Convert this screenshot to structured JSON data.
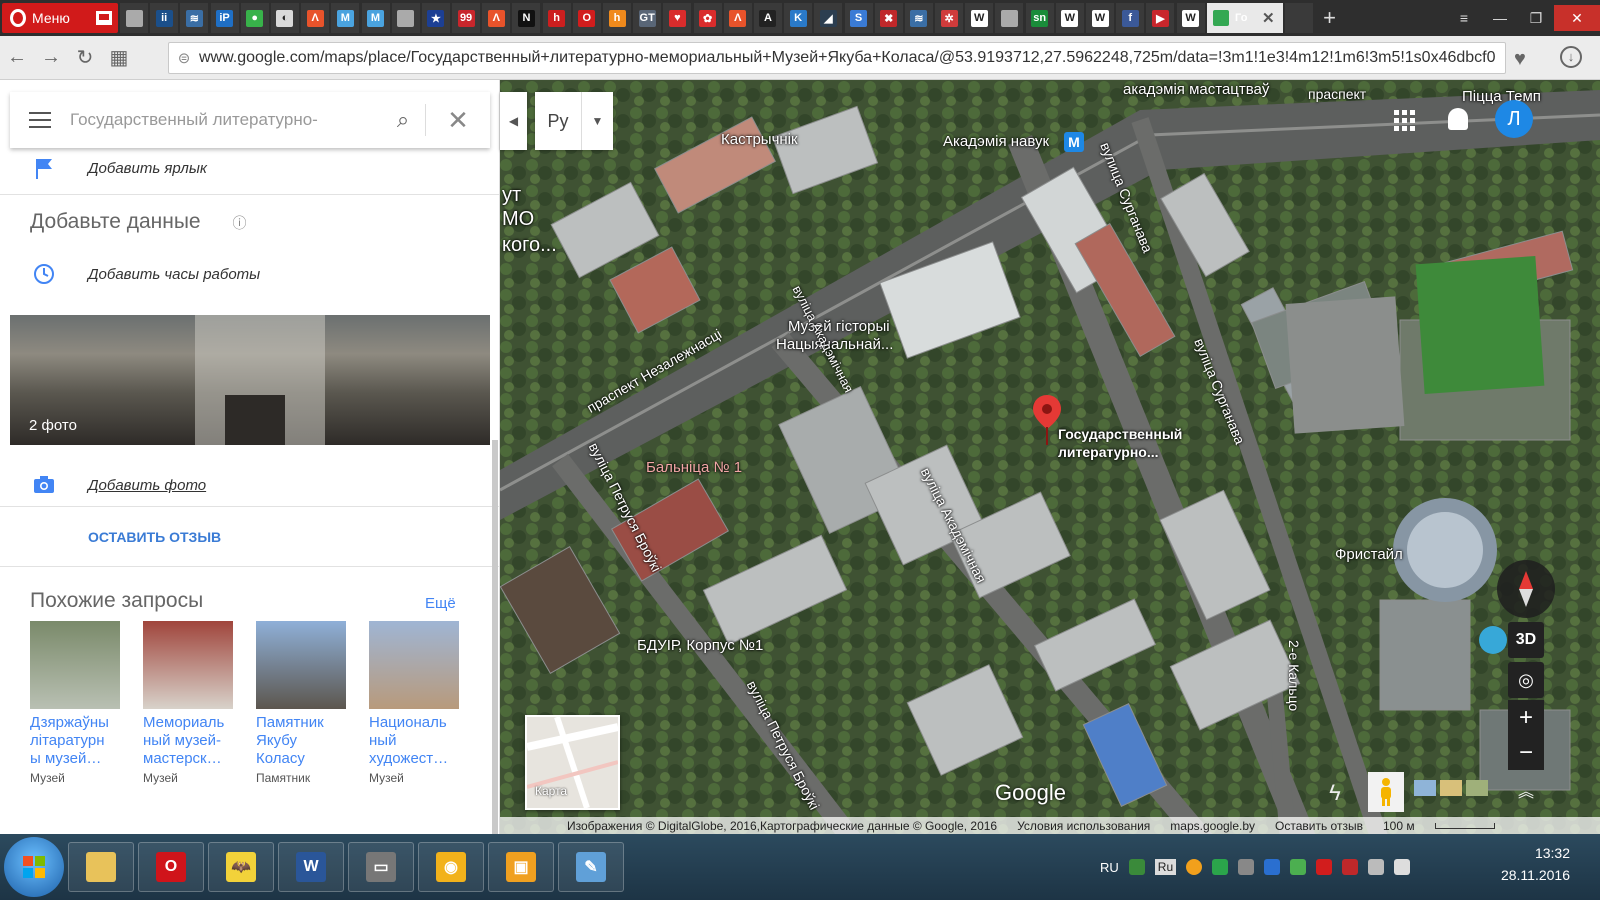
{
  "browser": {
    "menu_label": "Меню",
    "active_tab_label": "Го",
    "url": "www.google.com/maps/place/Государственный+литературно-мемориальный+Музей+Якуба+Коласа/@53.9193712,27.5962248,725m/data=!3m1!1e3!4m12!1m6!3m5!1s0x46dbcf0",
    "tab_icons": [
      {
        "label": "",
        "color": "#aaaaaa"
      },
      {
        "label": "ii",
        "color": "#1b4f8a"
      },
      {
        "label": "≋",
        "color": "#3a6ea5"
      },
      {
        "label": "iP",
        "color": "#1f6fc5"
      },
      {
        "label": "●",
        "color": "#38b24a"
      },
      {
        "label": "◐",
        "color": "#d9d9d9"
      },
      {
        "label": "Λ",
        "color": "#e8532b"
      },
      {
        "label": "M",
        "color": "#4aa3df"
      },
      {
        "label": "M",
        "color": "#4aa3df"
      },
      {
        "label": "",
        "color": "#aaaaaa"
      },
      {
        "label": "★",
        "color": "#1c3f94"
      },
      {
        "label": "99",
        "color": "#c8262c"
      },
      {
        "label": "Λ",
        "color": "#e8532b"
      },
      {
        "label": "N",
        "color": "#111111"
      },
      {
        "label": "h",
        "color": "#cc1f1f"
      },
      {
        "label": "O",
        "color": "#d21d1d"
      },
      {
        "label": "h",
        "color": "#f08a1c"
      },
      {
        "label": "GT",
        "color": "#596677"
      },
      {
        "label": "♥",
        "color": "#d92c2c"
      },
      {
        "label": "✿",
        "color": "#d92c2c"
      },
      {
        "label": "Λ",
        "color": "#e8532b"
      },
      {
        "label": "A",
        "color": "#222222"
      },
      {
        "label": "K",
        "color": "#2a7ac9"
      },
      {
        "label": "◢",
        "color": "#2c3e50"
      },
      {
        "label": "S",
        "color": "#3a7bd5"
      },
      {
        "label": "✖",
        "color": "#c0282a"
      },
      {
        "label": "≋",
        "color": "#3a6ea5"
      },
      {
        "label": "✲",
        "color": "#cf3b3b"
      },
      {
        "label": "W",
        "color": "#ffffff"
      },
      {
        "label": "",
        "color": "#aaaaaa"
      },
      {
        "label": "sn",
        "color": "#1a8c3a"
      },
      {
        "label": "W",
        "color": "#ffffff"
      },
      {
        "label": "W",
        "color": "#ffffff"
      },
      {
        "label": "f",
        "color": "#3b5998"
      },
      {
        "label": "▶",
        "color": "#c8262c"
      },
      {
        "label": "W",
        "color": "#ffffff"
      }
    ]
  },
  "panel": {
    "search_text": "Государственный литературно-",
    "add_label": "Добавить ярлык",
    "add_data_heading": "Добавьте данные",
    "add_hours": "Добавить часы работы",
    "photo_count": "2 фото",
    "add_photo": "Добавить фото",
    "leave_review": "ОСТАВИТЬ ОТЗЫВ",
    "similar_heading": "Похожие запросы",
    "more_link": "Ещё",
    "similar": [
      {
        "name_lines": [
          "Дзяржаўны",
          "літаратурн",
          "ы музей…"
        ],
        "type": "Музей",
        "colors": [
          "#7a8a6a",
          "#b9c0b3"
        ]
      },
      {
        "name_lines": [
          "Мемориаль",
          "ный музей-",
          "мастерск…"
        ],
        "type": "Музей",
        "colors": [
          "#a0453c",
          "#d8d2ca"
        ]
      },
      {
        "name_lines": [
          "Памятник",
          "Якубу",
          "Коласу"
        ],
        "type": "Памятник",
        "colors": [
          "#8fb0d8",
          "#5c564e"
        ]
      },
      {
        "name_lines": [
          "Националь",
          "ный",
          "художест…"
        ],
        "type": "Музей",
        "colors": [
          "#9fb5d4",
          "#b89a7c"
        ]
      }
    ]
  },
  "map": {
    "lang_value": "Ру",
    "avatar_letter": "Л",
    "compass_label": "3D",
    "minimap_label": "Карта",
    "google_logo": "Google",
    "labels": {
      "akademiya_mast": "акадэмія мастацтваў",
      "praspekt_top": "праспект",
      "pizza": "Піцца Темп",
      "kastrychnik": "Кастрычнік",
      "akademiya_navuk": "Акадэмія навук",
      "left_1": "ут",
      "left_2": "МО",
      "left_3": "кого...",
      "museum_1": "Музей гісторыі",
      "museum_2": "Нацыянальнай...",
      "place_1": "Государственный",
      "place_2": "литературно...",
      "balnitsa": "Бальніца № 1",
      "freestyle": "Фристайл",
      "bduir": "БДУІР, Корпус №1",
      "street_surganava1": "вулица Сурганава",
      "street_surganava2": "вуліца Сурганава",
      "street_nezalezh": "праспект Незалежнасці",
      "street_akad": "вуліца Акадэмічная",
      "street_akad_top": "вуліца Акадэмічная",
      "street_petrusya1": "вуліца Петруся Броўкі",
      "street_petrusya2": "вуліца Петруся Броўкі",
      "street_kaltso": "2-е Кальцо"
    },
    "attribution": {
      "images": "Изображения © DigitalGlobe, 2016,Картографические данные © Google, 2016",
      "terms": "Условия использования",
      "domain": "maps.google.by",
      "feedback": "Оставить отзыв",
      "scale": "100 м"
    }
  },
  "taskbar": {
    "lang": "RU",
    "keyboard": "Ru",
    "time": "13:32",
    "date": "28.11.2016",
    "apps": [
      {
        "label": "",
        "color": "#e8c25a"
      },
      {
        "label": "O",
        "color": "#d0141a"
      },
      {
        "label": "🦇",
        "color": "#f2d23a"
      },
      {
        "label": "W",
        "color": "#2a5699"
      },
      {
        "label": "▭",
        "color": "#777777"
      },
      {
        "label": "◉",
        "color": "#f2b21b"
      },
      {
        "label": "▣",
        "color": "#f0a020"
      },
      {
        "label": "✎",
        "color": "#60a0d8"
      }
    ]
  }
}
